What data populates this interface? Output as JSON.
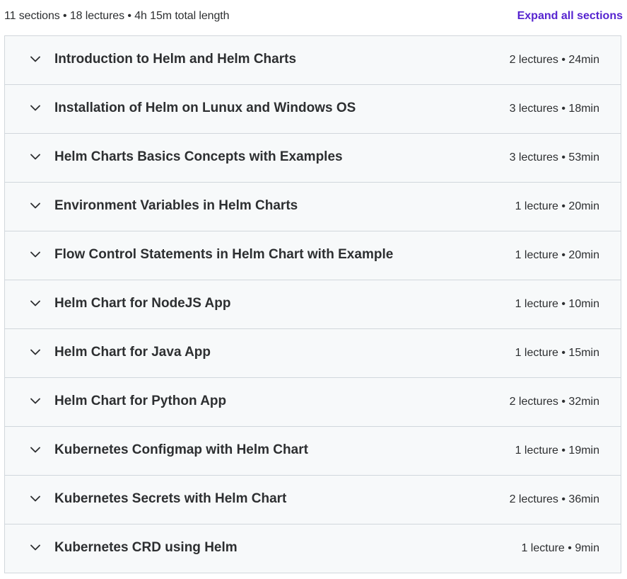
{
  "summary": {
    "text": "11 sections • 18 lectures • 4h 15m total length",
    "expand_all_label": "Expand all sections"
  },
  "colors": {
    "accent": "#5624d0",
    "section_bg": "#f7f9fa",
    "border": "#d1d7dc",
    "text": "#2d2f31"
  },
  "sections": [
    {
      "title": "Introduction to Helm and Helm Charts",
      "meta": "2 lectures • 24min",
      "icon": "chevron-down-icon"
    },
    {
      "title": "Installation of Helm on Lunux and Windows OS",
      "meta": "3 lectures • 18min",
      "icon": "chevron-down-icon"
    },
    {
      "title": "Helm Charts Basics Concepts with Examples",
      "meta": "3 lectures • 53min",
      "icon": "chevron-down-icon"
    },
    {
      "title": "Environment Variables in Helm Charts",
      "meta": "1 lecture • 20min",
      "icon": "chevron-down-icon"
    },
    {
      "title": "Flow Control Statements in Helm Chart with Example",
      "meta": "1 lecture • 20min",
      "icon": "chevron-down-icon"
    },
    {
      "title": "Helm Chart for NodeJS App",
      "meta": "1 lecture • 10min",
      "icon": "chevron-down-icon"
    },
    {
      "title": "Helm Chart for Java App",
      "meta": "1 lecture • 15min",
      "icon": "chevron-down-icon"
    },
    {
      "title": "Helm Chart for Python App",
      "meta": "2 lectures • 32min",
      "icon": "chevron-down-icon"
    },
    {
      "title": "Kubernetes Configmap with Helm Chart",
      "meta": "1 lecture • 19min",
      "icon": "chevron-down-icon"
    },
    {
      "title": "Kubernetes Secrets with Helm Chart",
      "meta": "2 lectures • 36min",
      "icon": "chevron-down-icon"
    },
    {
      "title": "Kubernetes CRD using Helm",
      "meta": "1 lecture • 9min",
      "icon": "chevron-down-icon"
    }
  ]
}
